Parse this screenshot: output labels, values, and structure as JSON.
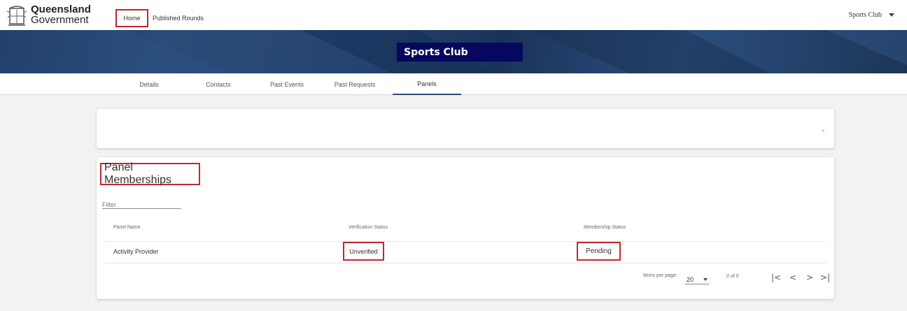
{
  "header": {
    "logo_line1": "Queensland",
    "logo_line2": "Government",
    "nav": [
      "Home",
      "Published Rounds"
    ],
    "user": "Sports Club"
  },
  "banner": {
    "title": "Sports Club"
  },
  "tabs": [
    {
      "label": "Details"
    },
    {
      "label": "Contacts"
    },
    {
      "label": "Past Events"
    },
    {
      "label": "Past Requests"
    },
    {
      "label": "Panels"
    }
  ],
  "active_tab": "Panels",
  "collapse_card": {
    "icon": "chevron-down-icon"
  },
  "panel_card": {
    "title": "Panel Memberships",
    "filter_placeholder": "Filter",
    "columns": [
      "Panel Name",
      "Verification Status",
      "Membership Status"
    ],
    "rows": [
      {
        "panel_name": "Activity Provider",
        "verification_status": "Unverified",
        "membership_status": "Pending"
      }
    ],
    "pagination": {
      "items_per_page_label": "Items per page:",
      "page_size": "20",
      "range": "0 of 0",
      "buttons": [
        "first-page-icon",
        "previous-page-icon",
        "next-page-icon",
        "last-page-icon"
      ]
    }
  },
  "colors": {
    "highlight": "#c0282d",
    "banner_title_bg": "#05085e",
    "active_tab": "#2b4c7e"
  }
}
